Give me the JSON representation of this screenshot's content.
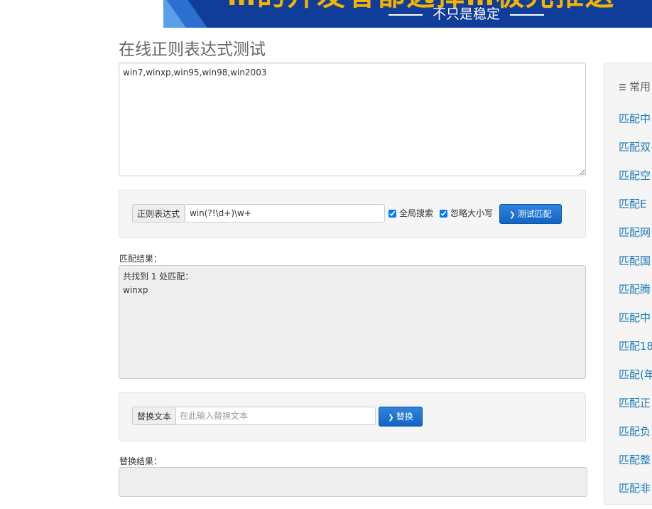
{
  "banner": {
    "headline": "…的开发者都选择…极光推送",
    "slogan": "不只是稳定"
  },
  "page": {
    "title": "在线正则表达式测试"
  },
  "source": {
    "text": "win7,winxp,win95,win98,win2003"
  },
  "regex_form": {
    "addon_label": "正则表达式",
    "pattern_value": "win(?!\\d+)\\w+",
    "global_label": "全局搜索",
    "global_checked": true,
    "ignore_case_label": "忽略大小写",
    "ignore_case_checked": true,
    "test_button_label": "测试匹配"
  },
  "match_result": {
    "label": "匹配结果：",
    "text": "共找到 1 处匹配：\nwinxp"
  },
  "replace_form": {
    "addon_label": "替换文本",
    "placeholder": "在此输入替换文本",
    "replace_button_label": "替换"
  },
  "replace_result": {
    "label": "替换结果："
  },
  "sidebar": {
    "header": "常用",
    "links": [
      "匹配中",
      "匹配双",
      "匹配空",
      "匹配E",
      "匹配网",
      "匹配国",
      "匹配腾",
      "匹配中",
      "匹配18",
      "匹配(年",
      "匹配正",
      "匹配负",
      "匹配整",
      "匹配非"
    ]
  },
  "colors": {
    "banner_bg": "#0f3d99",
    "accent_button": "#1a6fd1",
    "link": "#1a7bb9"
  }
}
